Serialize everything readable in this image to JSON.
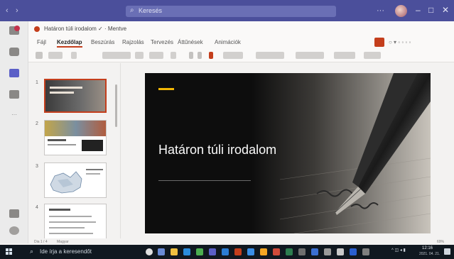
{
  "window": {
    "search_placeholder": "Keresés",
    "colors": {
      "teams_bar": "#4b4f9b",
      "accent": "#c43e1c"
    }
  },
  "app_bar": {
    "doc_title": "Határon túli irodalom ✓ · Mentve"
  },
  "ribbon": {
    "tabs": [
      "Fájl",
      "Kezdőlap",
      "Beszúrás",
      "Rajzolás",
      "Tervezés",
      "Áttűnések",
      "Animációk"
    ],
    "active_tab": "Kezdőlap"
  },
  "slides": {
    "count_shown": 4,
    "numbers": [
      "1",
      "2",
      "3",
      "4"
    ]
  },
  "slide": {
    "title": "Határon túli irodalom",
    "accent_color": "#f2b705"
  },
  "status": {
    "left": "Dia 1 / 4",
    "middle": "Magyar",
    "zoom": "69%"
  },
  "taskbar": {
    "search_text": "Ide írja a keresendőt",
    "time": "12:16",
    "date": "2021. 04. 21."
  }
}
